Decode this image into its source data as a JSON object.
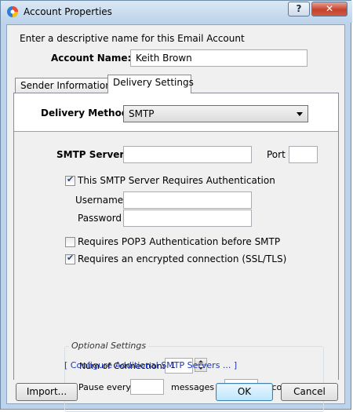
{
  "window": {
    "title": "Account Properties",
    "help_label": "?",
    "close_label": "✕"
  },
  "intro_text": "Enter a descriptive name for this Email Account",
  "account_name": {
    "label": "Account Name:",
    "value": "Keith Brown"
  },
  "tabs": [
    {
      "label": "Sender Information",
      "active": false
    },
    {
      "label": "Delivery Settings",
      "active": true
    }
  ],
  "delivery_method": {
    "label": "Delivery Method",
    "value": "SMTP"
  },
  "smtp_server": {
    "label": "SMTP Server",
    "value": "",
    "port_label": "Port",
    "port_value": ""
  },
  "auth": {
    "requires_auth_label": "This SMTP Server Requires Authentication",
    "requires_auth_checked": true,
    "username_label": "Username",
    "username_value": "",
    "password_label": "Password",
    "password_value": ""
  },
  "pop3_before_smtp": {
    "label": "Requires POP3 Authentication before SMTP",
    "checked": false
  },
  "ssl": {
    "label": "Requires an encrypted connection (SSL/TLS)",
    "checked": true
  },
  "optional": {
    "title": "Optional Settings",
    "connections_label": "Num of Connections",
    "connections_value": "1",
    "pause_every_label": "Pause every",
    "pause_every_value": "",
    "messages_for_label": "messages for",
    "messages_for_value": "",
    "seconds_label": "seconds"
  },
  "configure_link": "[ Configure Additional SMTP Servers ... ]",
  "buttons": {
    "import": "Import...",
    "ok": "OK",
    "cancel": "Cancel"
  }
}
